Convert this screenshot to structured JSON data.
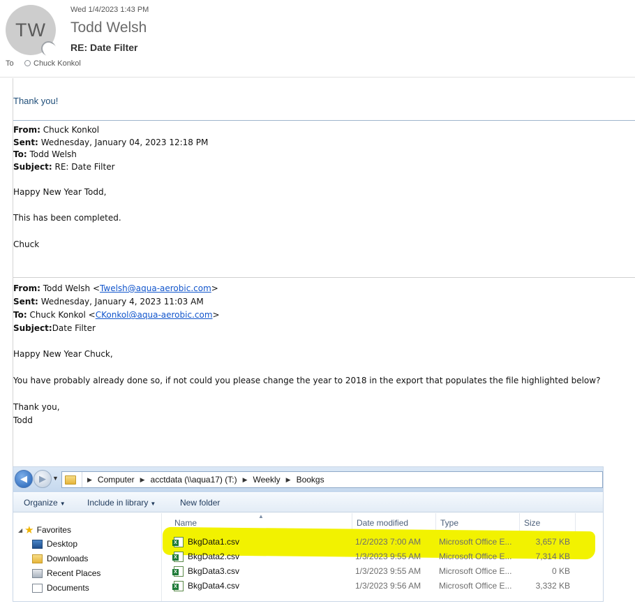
{
  "header": {
    "avatar_initials": "TW",
    "date": "Wed 1/4/2023 1:43 PM",
    "sender": "Todd Welsh",
    "subject": "RE: Date Filter",
    "to_label": "To",
    "to_name": "Chuck Konkol"
  },
  "reply_text": "Thank you!",
  "quote1": {
    "from_label": "From:",
    "from": "Chuck Konkol",
    "sent_label": "Sent:",
    "sent": "Wednesday, January 04, 2023 12:18 PM",
    "to_label": "To:",
    "to": "Todd Welsh",
    "subject_label": "Subject:",
    "subject": "RE: Date Filter",
    "lines": [
      "Happy New Year Todd,",
      "This has been completed.",
      "Chuck"
    ]
  },
  "quote2": {
    "from_label": "From:",
    "from_name": "Todd Welsh <",
    "from_email": "Twelsh@aqua-aerobic.com",
    "from_close": ">",
    "sent_label": "Sent:",
    "sent": "Wednesday, January 4, 2023 11:03 AM",
    "to_label": "To:",
    "to_name": "Chuck Konkol <",
    "to_email": "CKonkol@aqua-aerobic.com",
    "to_close": ">",
    "subject_label": "Subject:",
    "subject": "Date Filter",
    "greeting": "Happy New Year Chuck,",
    "body": "You have probably already done so, if  not could you please change the year to 2018  in the export that populates the file highlighted below?",
    "closing1": "Thank you,",
    "closing2": "Todd"
  },
  "explorer": {
    "path": [
      "Computer",
      "acctdata (\\\\aqua17) (T:)",
      "Weekly",
      "Bookgs"
    ],
    "toolbar": {
      "organize": "Organize",
      "include": "Include in library",
      "new_folder": "New folder"
    },
    "nav": [
      "Favorites",
      "Desktop",
      "Downloads",
      "Recent Places",
      "Documents"
    ],
    "columns": [
      "Name",
      "Date modified",
      "Type",
      "Size"
    ],
    "files": [
      {
        "name": "BkgData1.csv",
        "date": "1/2/2023 7:00 AM",
        "type": "Microsoft Office E...",
        "size": "3,657 KB"
      },
      {
        "name": "BkgData2.csv",
        "date": "1/3/2023 9:55 AM",
        "type": "Microsoft Office E...",
        "size": "7,314 KB"
      },
      {
        "name": "BkgData3.csv",
        "date": "1/3/2023 9:55 AM",
        "type": "Microsoft Office E...",
        "size": "0 KB"
      },
      {
        "name": "BkgData4.csv",
        "date": "1/3/2023 9:56 AM",
        "type": "Microsoft Office E...",
        "size": "3,332 KB"
      }
    ]
  },
  "colors": {
    "highlight": "#f2f200",
    "link": "#1155cc",
    "reply": "#1f4e79"
  }
}
